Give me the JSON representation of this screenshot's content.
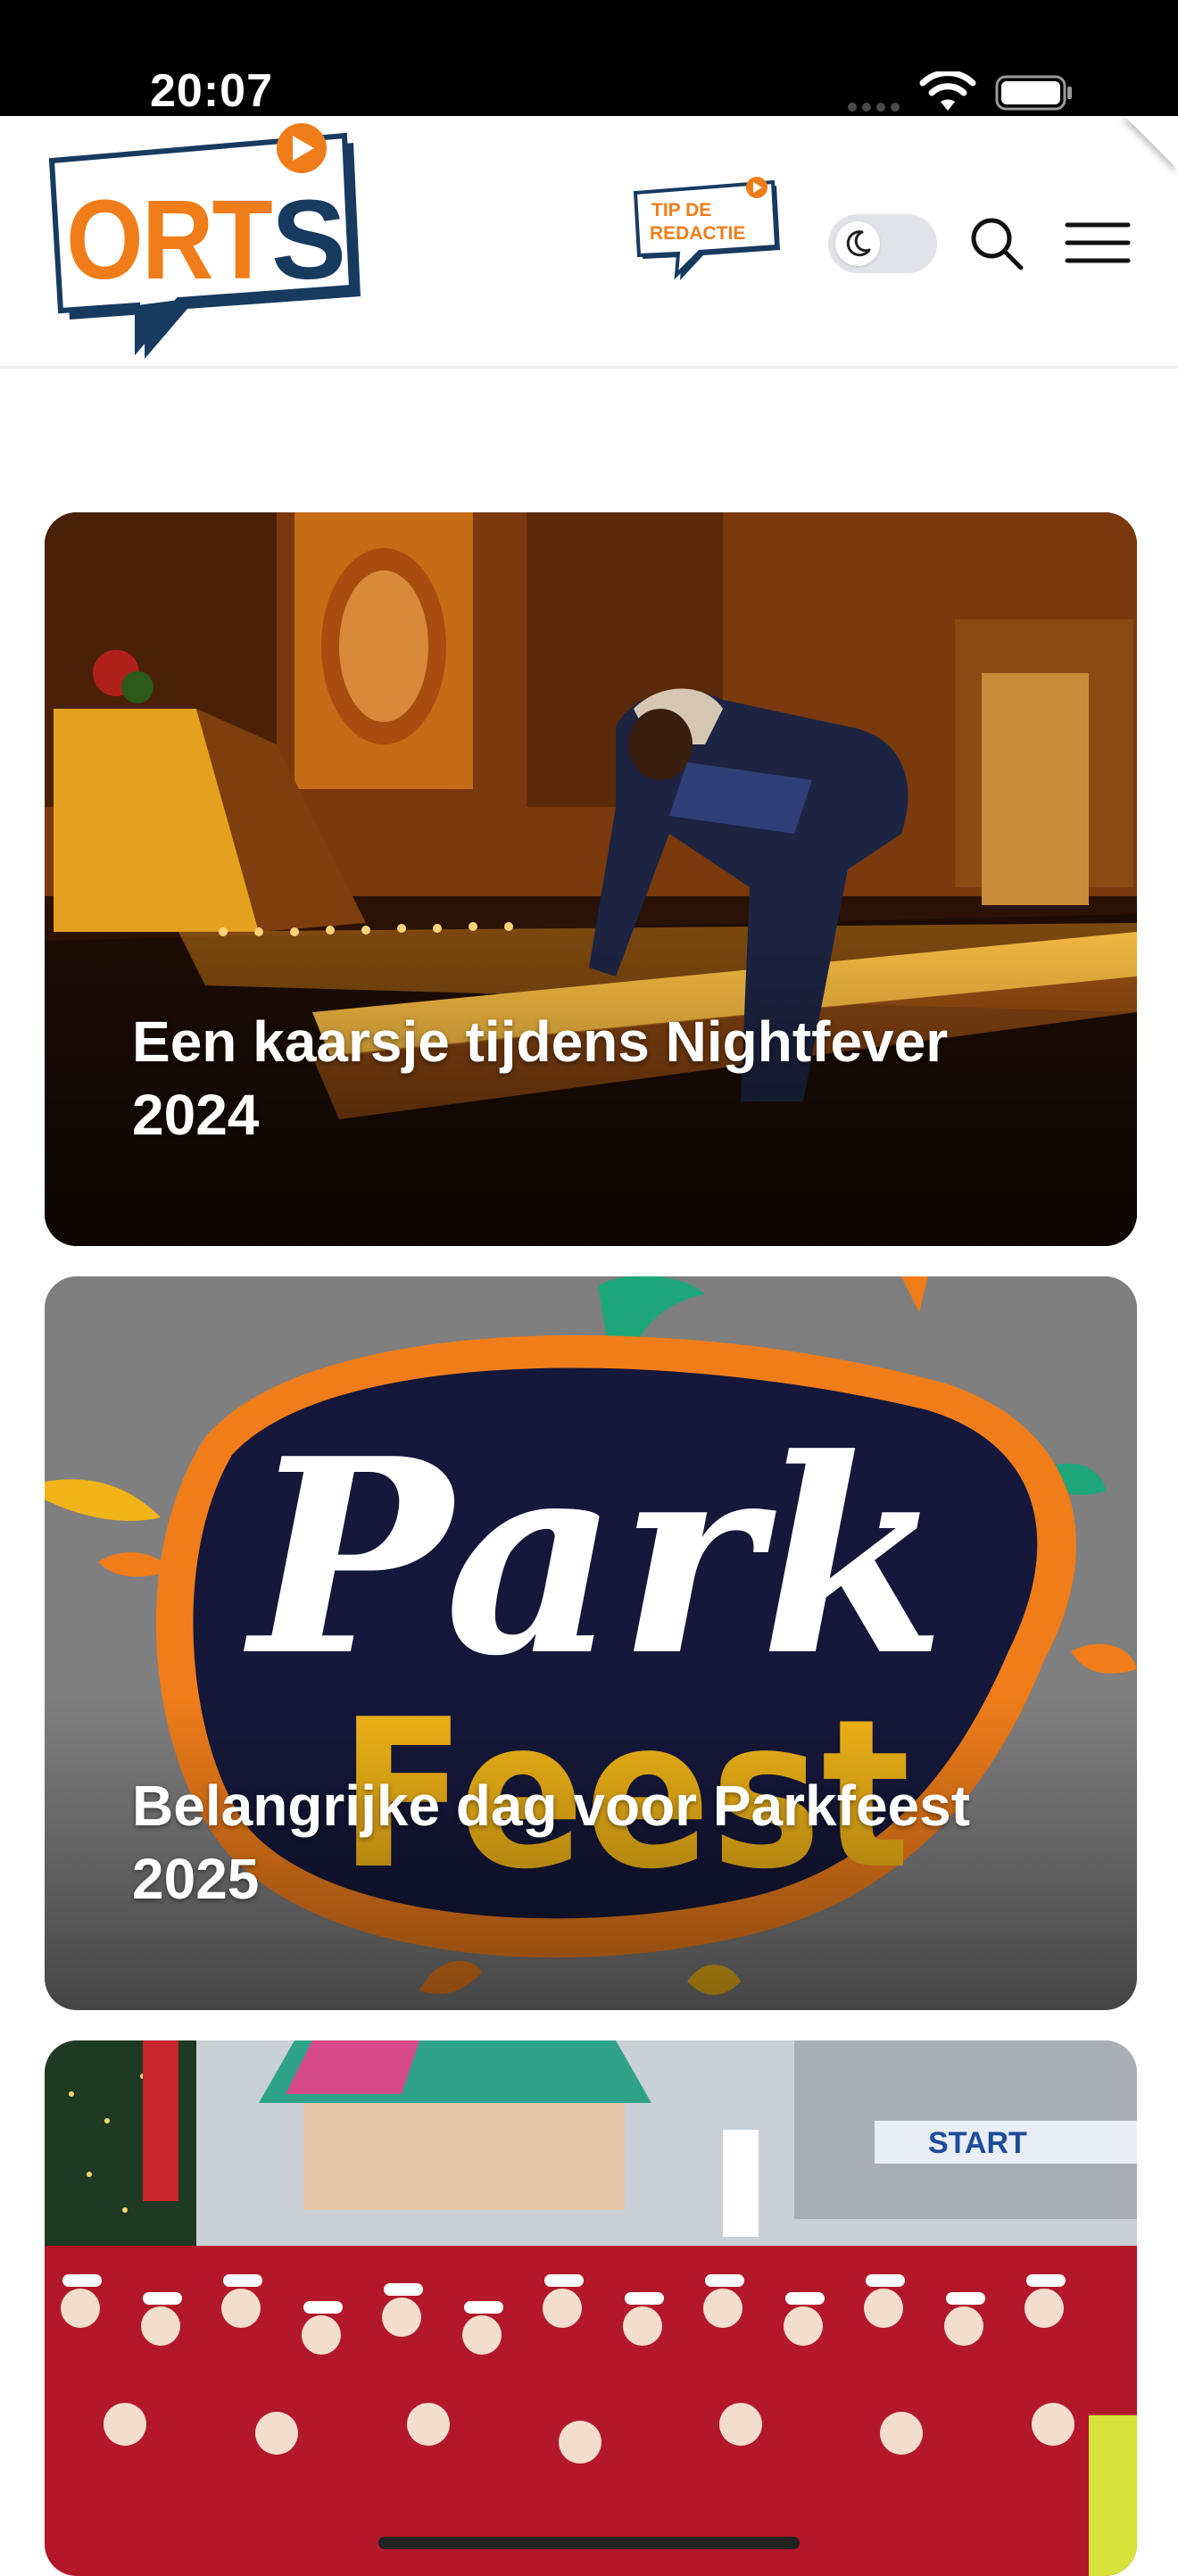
{
  "status_bar": {
    "time": "20:07"
  },
  "header": {
    "logo_text": "ORTS",
    "tip_badge_text": [
      "TIP DE",
      "REDACTIE"
    ],
    "theme_toggle_state": "light",
    "icons": [
      "moon-icon",
      "search-icon",
      "menu-icon"
    ],
    "brand_colors": {
      "orange": "#f07d1a",
      "navy": "#173a5f"
    }
  },
  "articles": [
    {
      "title": "Een kaarsje tijdens Nightfever 2024",
      "image": "church-candles-photo"
    },
    {
      "title": "Belangrijke dag voor Parkfeest 2025",
      "image": "parkfeest-logo"
    },
    {
      "title": "",
      "image": "santa-run-photo"
    }
  ]
}
